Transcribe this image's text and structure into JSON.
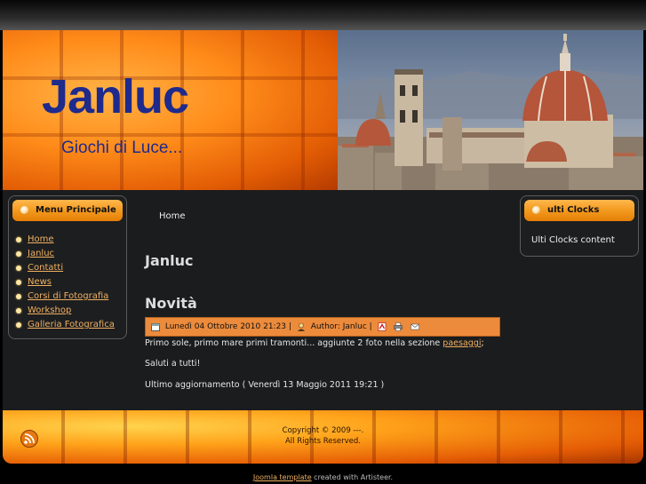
{
  "header": {
    "title": "Janluc",
    "slogan": "Giochi di Luce..."
  },
  "left_module": {
    "title": "Menu Principale",
    "items": [
      "Home",
      "Janluc",
      "Contatti",
      "News",
      "Corsi di Fotografia",
      "Workshop",
      "Galleria Fotografica"
    ]
  },
  "content": {
    "breadcrumb": "Home",
    "page_title": "Janluc",
    "article_title": "Novità",
    "meta": {
      "date": "Lunedì 04 Ottobre 2010 21:23",
      "sep1": "|",
      "author": "Author: Janluc",
      "sep2": "|"
    },
    "paragraph1_pre": "Primo sole, primo mare primi tramonti... aggiunte 2 foto nella sezione",
    "paragraph1_link": "paesaggi",
    "paragraph1_post": ";",
    "paragraph2": "Saluti a tutti!",
    "modified": "Ultimo aggiornamento ( Venerdì 13 Maggio 2011 19:21 )"
  },
  "right_module": {
    "title": "ulti Clocks",
    "content": "Ulti Clocks content"
  },
  "footer": {
    "copyright": "Copyright © 2009 ---.",
    "rights": "All Rights Reserved."
  },
  "credit": {
    "link": "Joomla template",
    "text": " created with Artisteer."
  },
  "icons": {
    "meta_date": "calendar-icon",
    "meta_author": "user-icon",
    "pdf": "pdf-icon",
    "print": "print-icon",
    "email": "email-icon",
    "footer": "rss-icon"
  },
  "colors": {
    "accent": "#ec8b3c",
    "title_blue": "#1e2a8c",
    "link": "#f0b060"
  }
}
